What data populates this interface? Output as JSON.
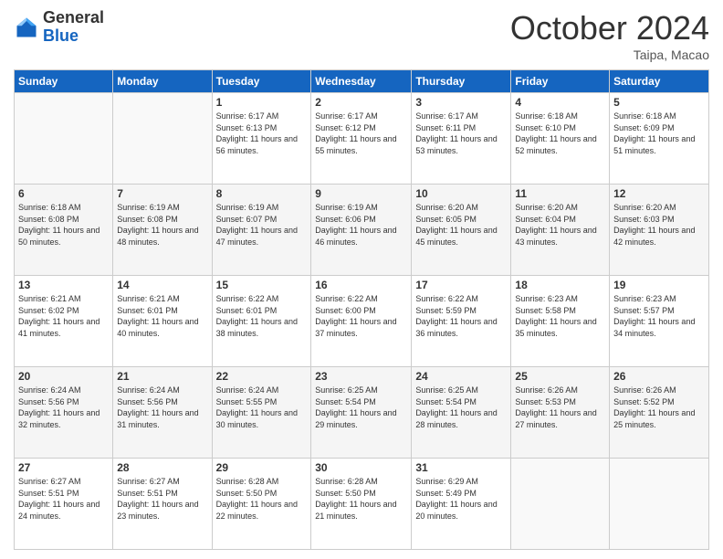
{
  "logo": {
    "general": "General",
    "blue": "Blue"
  },
  "header": {
    "month": "October 2024",
    "location": "Taipa, Macao"
  },
  "weekdays": [
    "Sunday",
    "Monday",
    "Tuesday",
    "Wednesday",
    "Thursday",
    "Friday",
    "Saturday"
  ],
  "weeks": [
    [
      {
        "day": "",
        "info": ""
      },
      {
        "day": "",
        "info": ""
      },
      {
        "day": "1",
        "info": "Sunrise: 6:17 AM\nSunset: 6:13 PM\nDaylight: 11 hours and 56 minutes."
      },
      {
        "day": "2",
        "info": "Sunrise: 6:17 AM\nSunset: 6:12 PM\nDaylight: 11 hours and 55 minutes."
      },
      {
        "day": "3",
        "info": "Sunrise: 6:17 AM\nSunset: 6:11 PM\nDaylight: 11 hours and 53 minutes."
      },
      {
        "day": "4",
        "info": "Sunrise: 6:18 AM\nSunset: 6:10 PM\nDaylight: 11 hours and 52 minutes."
      },
      {
        "day": "5",
        "info": "Sunrise: 6:18 AM\nSunset: 6:09 PM\nDaylight: 11 hours and 51 minutes."
      }
    ],
    [
      {
        "day": "6",
        "info": "Sunrise: 6:18 AM\nSunset: 6:08 PM\nDaylight: 11 hours and 50 minutes."
      },
      {
        "day": "7",
        "info": "Sunrise: 6:19 AM\nSunset: 6:08 PM\nDaylight: 11 hours and 48 minutes."
      },
      {
        "day": "8",
        "info": "Sunrise: 6:19 AM\nSunset: 6:07 PM\nDaylight: 11 hours and 47 minutes."
      },
      {
        "day": "9",
        "info": "Sunrise: 6:19 AM\nSunset: 6:06 PM\nDaylight: 11 hours and 46 minutes."
      },
      {
        "day": "10",
        "info": "Sunrise: 6:20 AM\nSunset: 6:05 PM\nDaylight: 11 hours and 45 minutes."
      },
      {
        "day": "11",
        "info": "Sunrise: 6:20 AM\nSunset: 6:04 PM\nDaylight: 11 hours and 43 minutes."
      },
      {
        "day": "12",
        "info": "Sunrise: 6:20 AM\nSunset: 6:03 PM\nDaylight: 11 hours and 42 minutes."
      }
    ],
    [
      {
        "day": "13",
        "info": "Sunrise: 6:21 AM\nSunset: 6:02 PM\nDaylight: 11 hours and 41 minutes."
      },
      {
        "day": "14",
        "info": "Sunrise: 6:21 AM\nSunset: 6:01 PM\nDaylight: 11 hours and 40 minutes."
      },
      {
        "day": "15",
        "info": "Sunrise: 6:22 AM\nSunset: 6:01 PM\nDaylight: 11 hours and 38 minutes."
      },
      {
        "day": "16",
        "info": "Sunrise: 6:22 AM\nSunset: 6:00 PM\nDaylight: 11 hours and 37 minutes."
      },
      {
        "day": "17",
        "info": "Sunrise: 6:22 AM\nSunset: 5:59 PM\nDaylight: 11 hours and 36 minutes."
      },
      {
        "day": "18",
        "info": "Sunrise: 6:23 AM\nSunset: 5:58 PM\nDaylight: 11 hours and 35 minutes."
      },
      {
        "day": "19",
        "info": "Sunrise: 6:23 AM\nSunset: 5:57 PM\nDaylight: 11 hours and 34 minutes."
      }
    ],
    [
      {
        "day": "20",
        "info": "Sunrise: 6:24 AM\nSunset: 5:56 PM\nDaylight: 11 hours and 32 minutes."
      },
      {
        "day": "21",
        "info": "Sunrise: 6:24 AM\nSunset: 5:56 PM\nDaylight: 11 hours and 31 minutes."
      },
      {
        "day": "22",
        "info": "Sunrise: 6:24 AM\nSunset: 5:55 PM\nDaylight: 11 hours and 30 minutes."
      },
      {
        "day": "23",
        "info": "Sunrise: 6:25 AM\nSunset: 5:54 PM\nDaylight: 11 hours and 29 minutes."
      },
      {
        "day": "24",
        "info": "Sunrise: 6:25 AM\nSunset: 5:54 PM\nDaylight: 11 hours and 28 minutes."
      },
      {
        "day": "25",
        "info": "Sunrise: 6:26 AM\nSunset: 5:53 PM\nDaylight: 11 hours and 27 minutes."
      },
      {
        "day": "26",
        "info": "Sunrise: 6:26 AM\nSunset: 5:52 PM\nDaylight: 11 hours and 25 minutes."
      }
    ],
    [
      {
        "day": "27",
        "info": "Sunrise: 6:27 AM\nSunset: 5:51 PM\nDaylight: 11 hours and 24 minutes."
      },
      {
        "day": "28",
        "info": "Sunrise: 6:27 AM\nSunset: 5:51 PM\nDaylight: 11 hours and 23 minutes."
      },
      {
        "day": "29",
        "info": "Sunrise: 6:28 AM\nSunset: 5:50 PM\nDaylight: 11 hours and 22 minutes."
      },
      {
        "day": "30",
        "info": "Sunrise: 6:28 AM\nSunset: 5:50 PM\nDaylight: 11 hours and 21 minutes."
      },
      {
        "day": "31",
        "info": "Sunrise: 6:29 AM\nSunset: 5:49 PM\nDaylight: 11 hours and 20 minutes."
      },
      {
        "day": "",
        "info": ""
      },
      {
        "day": "",
        "info": ""
      }
    ]
  ]
}
